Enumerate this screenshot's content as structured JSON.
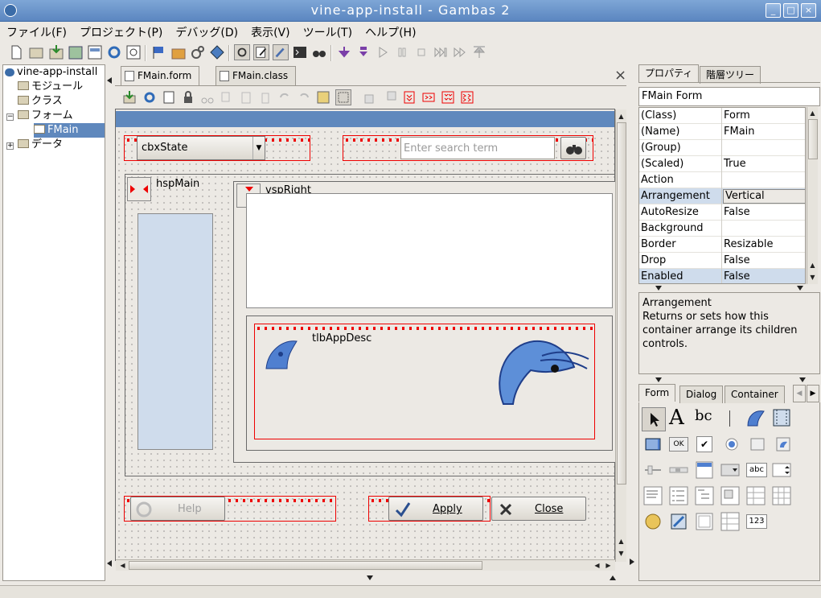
{
  "window": {
    "title": "vine-app-install - Gambas 2",
    "min": "_",
    "max": "□",
    "close": "×"
  },
  "menu": [
    "ファイル(F)",
    "プロジェクト(P)",
    "デバッグ(D)",
    "表示(V)",
    "ツール(T)",
    "ヘルプ(H)"
  ],
  "tree": {
    "root": "vine-app-install",
    "items": [
      "モジュール",
      "クラス",
      "フォーム",
      "FMain",
      "データ"
    ]
  },
  "editor": {
    "tabs": [
      "FMain.form",
      "FMain.class"
    ],
    "close": "×"
  },
  "form": {
    "combo_label": "cbxState",
    "search_placeholder": "Enter search term",
    "hsp_label": "hspMain",
    "vsp_label": "vspRight",
    "tlb_label": "tlbAppDesc",
    "help_label": "Help",
    "apply_label": "Apply",
    "close_label": "Close"
  },
  "props": {
    "tabs": [
      "プロパティ",
      "階層ツリー"
    ],
    "header": "FMain Form",
    "rows": [
      {
        "k": "(Class)",
        "v": "Form"
      },
      {
        "k": "(Name)",
        "v": "FMain"
      },
      {
        "k": "(Group)",
        "v": ""
      },
      {
        "k": "(Scaled)",
        "v": "True"
      },
      {
        "k": "Action",
        "v": ""
      },
      {
        "k": "Arrangement",
        "v": "Vertical"
      },
      {
        "k": "AutoResize",
        "v": "False"
      },
      {
        "k": "Background",
        "v": ""
      },
      {
        "k": "Border",
        "v": "Resizable"
      },
      {
        "k": "Drop",
        "v": "False"
      },
      {
        "k": "Enabled",
        "v": "False"
      }
    ],
    "desc_title": "Arrangement",
    "desc_text": "Returns or sets how this container arrange its children controls."
  },
  "toolbox": {
    "tabs": [
      "Form",
      "Dialog",
      "Container"
    ],
    "text_a": "A",
    "text_bc": "bc",
    "sub_b": "b",
    "sub_a": "a",
    "ok": "OK",
    "check": "✔",
    "abc": "abc",
    "num": "123"
  },
  "colors": {
    "accent": "#5f88bd",
    "selection": "#cfdcec",
    "frame": "#ee0000"
  }
}
